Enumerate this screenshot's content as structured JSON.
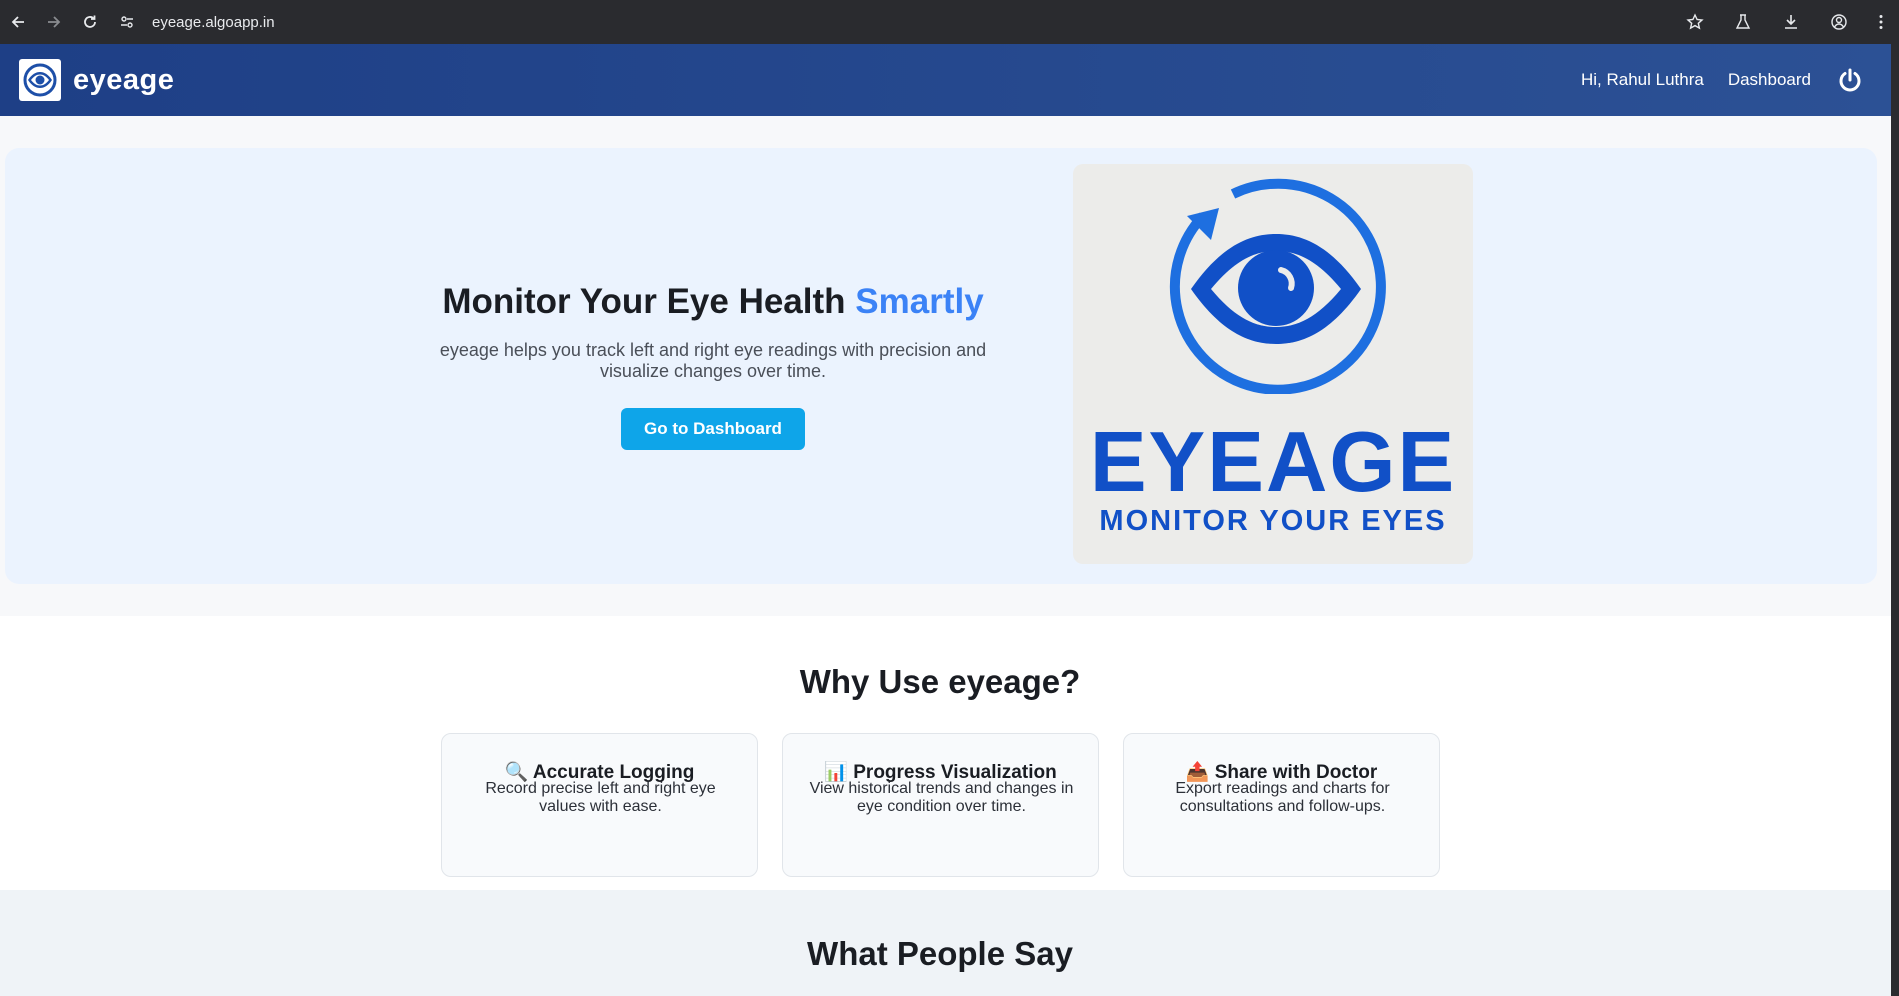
{
  "browser": {
    "url": "eyeage.algoapp.in"
  },
  "header": {
    "brand": "eyeage",
    "greeting": "Hi, Rahul Luthra",
    "dashboard_link": "Dashboard"
  },
  "hero": {
    "title_main": "Monitor Your Eye Health ",
    "title_accent": "Smartly",
    "subtitle": "eyeage helps you track left and right eye readings with precision and visualize changes over time.",
    "button": "Go to Dashboard",
    "image": {
      "word": "EYEAGE",
      "tagline": "MONITOR YOUR EYES"
    }
  },
  "features": {
    "heading": "Why Use eyeage?",
    "items": [
      {
        "icon": "🔍",
        "title": "Accurate Logging",
        "desc": "Record precise left and right eye values with ease."
      },
      {
        "icon": "📊",
        "title": "Progress Visualization",
        "desc": "View historical trends and changes in eye condition over time."
      },
      {
        "icon": "📤",
        "title": "Share with Doctor",
        "desc": "Export readings and charts for consultations and follow-ups."
      }
    ]
  },
  "testimonials": {
    "heading": "What People Say"
  },
  "colors": {
    "header_bg": "#1e3f86",
    "accent": "#3b82f6",
    "button": "#0ea5e9",
    "logo_blue": "#1150c7"
  }
}
